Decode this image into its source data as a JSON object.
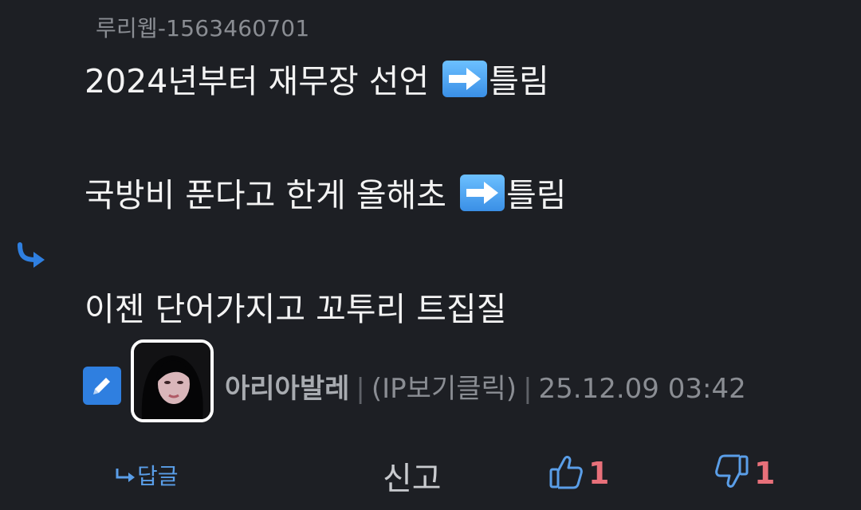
{
  "quote": {
    "header": "루리웹-1563460701"
  },
  "comment": {
    "line1_text": "2024년부터 재무장 선언",
    "line1_suffix": "틀림",
    "line2_text": "국방비 푼다고 한게 올해초",
    "line2_suffix": "틀림",
    "line3": "이젠 단어가지고 꼬투리 트집질"
  },
  "meta": {
    "author": "아리아발레",
    "ip_label": "(IP보기클릭)",
    "separator": "|",
    "timestamp": "25.12.09 03:42"
  },
  "actions": {
    "reply_label": "답글",
    "report_label": "신고",
    "like_count": "1",
    "dislike_count": "1"
  },
  "icons": {
    "reply_arrow": "reply-arrow-icon",
    "arrow_emoji": "right-arrow-emoji-icon",
    "edit": "pencil-icon",
    "like": "thumbs-up-icon",
    "dislike": "thumbs-down-icon"
  },
  "colors": {
    "background": "#1d1f24",
    "accent_blue": "#2f7fe0",
    "vote_red": "#e8707a",
    "muted_text": "#8a8d93"
  }
}
